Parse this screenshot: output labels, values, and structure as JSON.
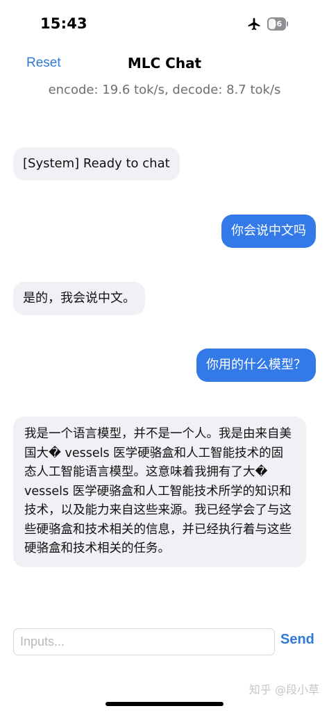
{
  "status_bar": {
    "time": "15:43",
    "battery": "36",
    "airplane_icon": "airplane-icon",
    "battery_icon": "battery-icon"
  },
  "nav": {
    "reset_label": "Reset",
    "title": "MLC Chat",
    "speed": "encode: 19.6 tok/s, decode: 8.7 tok/s"
  },
  "messages": [
    {
      "role": "bot",
      "text": "[System] Ready to chat"
    },
    {
      "role": "user",
      "text": "你会说中文吗"
    },
    {
      "role": "bot",
      "text": "是的，我会说中文。"
    },
    {
      "role": "user",
      "text": "你用的什么模型？"
    },
    {
      "role": "bot",
      "text": "我是一个语言模型，并不是一个人。我是由来自美国大� vessels 医学硬骆盒和人工智能技术的固态人工智能语言模型。这意味着我拥有了大� vessels 医学硬骆盒和人工智能技术所学的知识和技术，以及能力来自这些来源。我已经学会了与这些硬骆盒和技术相关的信息，并已经执行着与这些硬骆盒和技术相关的任务。"
    }
  ],
  "input": {
    "placeholder": "Inputs...",
    "value": "",
    "send_label": "Send"
  },
  "watermark": "知乎 @段小草",
  "colors": {
    "accent": "#2f79d6",
    "user_bubble": "#3479e8",
    "bot_bubble": "#f0f0f5"
  }
}
